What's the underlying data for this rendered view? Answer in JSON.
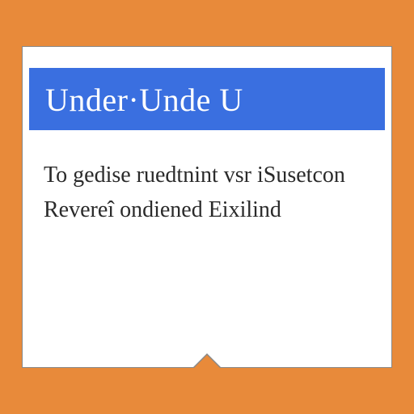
{
  "header": {
    "title": "Under·Unde U"
  },
  "body": {
    "text": "To gedise ruedtnint vsr iSusetcon Revereî ondiened Eixilind"
  },
  "colors": {
    "background": "#e88a3a",
    "header_bg": "#3a6fe0",
    "card_bg": "#ffffff"
  }
}
